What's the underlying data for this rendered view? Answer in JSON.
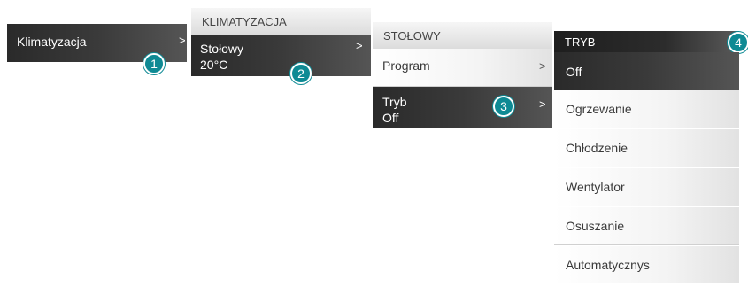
{
  "menu1": {
    "label": "Klimatyzacja",
    "badge": "1"
  },
  "menu2": {
    "header": "KLIMATYZACJA",
    "item_label": "Stołowy",
    "item_value": "20°C",
    "badge": "2"
  },
  "menu3": {
    "header": "STOŁOWY",
    "program_label": "Program",
    "tryb_label": "Tryb",
    "tryb_value": "Off",
    "badge": "3"
  },
  "menu4": {
    "header": "TRYB",
    "badge": "4",
    "options": [
      "Off",
      "Ogrzewanie",
      "Chłodzenie",
      "Wentylator",
      "Osuszanie",
      "Automatycznys"
    ],
    "selected": "Off"
  },
  "chevron": ">",
  "colors": {
    "badge": "#0e8a94",
    "dark": "#2a2a2a",
    "header": "#dcdcdc"
  }
}
